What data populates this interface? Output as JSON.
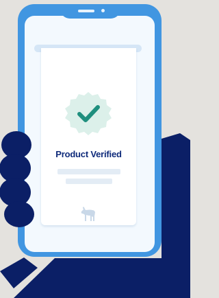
{
  "card": {
    "title": "Product Verified"
  },
  "icons": {
    "badge": "verified-check-badge-icon",
    "logo": "animal-logo-icon"
  },
  "colors": {
    "background": "#e4e2de",
    "phone": "#4196e1",
    "screen": "#f3f9fe",
    "hand": "#0b1f66",
    "badge": "#dcf0ea",
    "check": "#1f8f7e",
    "title": "#0e2a7a"
  }
}
